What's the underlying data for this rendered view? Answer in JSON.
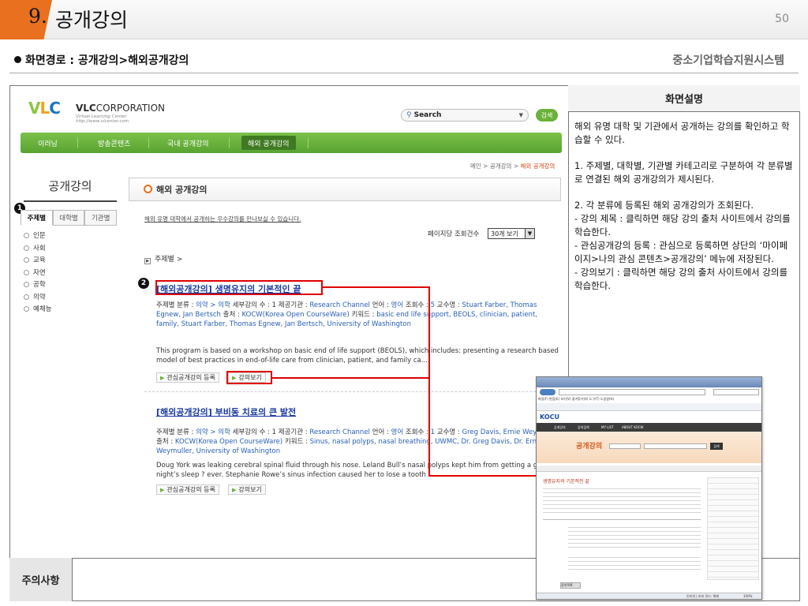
{
  "slide": {
    "section_number": "9.",
    "section_title": "공개강의",
    "page_number": "50",
    "screen_path": "화면경로 : 공개강의>해외공개강의",
    "system_name": "중소기업학습지원시스템"
  },
  "description": {
    "header": "화면설명",
    "summary": "해외 유명 대학 및 기관에서 공개하는 강의를 확인하고 학습할 수 있다.",
    "point1": "1. 주제별, 대학별, 기관별 카테고리로 구분하여 각 분류별로 연결된 해외 공개강의가 제시된다.",
    "point2_title": "2. 각 분류에 등록된 해외 공개강의가 조회된다.",
    "point2_a": "- 강의 제목 : 클릭하면 해당 강의 출처 사이트에서 강의를 학습한다.",
    "point2_b": "- 관심공개강의 등록 : 관심으로 등록하면 상단의 ‘마이페이지>나의 관심 콘텐츠>공개강의’ 메뉴에 저장된다.",
    "point2_c": "- 강의보기 : 클릭하면 해당 강의 출처 사이트에서 강의를 학습한다."
  },
  "notes": {
    "header": "주의사항"
  },
  "site": {
    "logo_mark": "VLC",
    "logo_bold": "VLC",
    "logo_rest": "CORPORATION",
    "logo_sub1": "Virtual Learning Center",
    "logo_sub2": "http://www.vlcenter.com",
    "search_placeholder": "Search",
    "search_button": "검색",
    "nav": [
      "이러닝",
      "방송콘텐츠",
      "국내 공개강의",
      "해외 공개강의"
    ],
    "breadcrumb_pre": "메인 > 공개강의 > ",
    "breadcrumb_current": "해외 공개강의",
    "sidebar_title": "공개강의",
    "sidebar_tabs": [
      "주제별",
      "대학별",
      "기관별"
    ],
    "sidebar_items": [
      "인문",
      "사회",
      "교육",
      "자연",
      "공학",
      "의약",
      "예체능"
    ],
    "content_title": "해외 공개강의",
    "intro": "해외 유명 대학에서 공개하는 우수강의를 만나보실 수 있습니다.",
    "per_page_label": "페이지당 조회건수",
    "per_page_value": "30개 보기",
    "category_path": "주제별 >",
    "badge1": "1",
    "badge2": "2",
    "items": [
      {
        "title": "[해외공개강의] 생명유지의 기본적인 끝",
        "meta1": "주제별 분류 : ",
        "cat_link": "의약 > 의학",
        "meta2": "   세부강의 수 : 1    제공기관 : ",
        "provider": "Research Channel",
        "meta3": "   언어 : ",
        "lang": "영어",
        "meta4": "   조회수 : ",
        "views": "5",
        "meta5": "   교수명 : ",
        "profs": "Stuart Farber, Thomas Egnew, Jan Bertsch",
        "meta6": "   출처 : ",
        "source": "KOCW(Korea Open CourseWare)",
        "meta7": "   키워드 : ",
        "keywords": "basic end life support, BEOLS, clinician, patient, family, Stuart Farber, Thomas Egnew, Jan Bertsch, University of Washington",
        "abstract": "This program is based on a workshop on basic end of life support (BEOLS), which includes: presenting a research based model of best practices in end-of-life care from clinician, patient, and family ca...",
        "btn_fav": "관심공개강의 등록",
        "btn_view": "강의보기"
      },
      {
        "title": "[해외공개강의] 부비동 치료의 큰 발전",
        "meta1": "주제별 분류 : ",
        "cat_link": "의약 > 의학",
        "meta2": "   세부강의 수 : 1    제공기관 : ",
        "provider": "Research Channel",
        "meta3": "   언어 : ",
        "lang": "영어",
        "meta4": "   조회수 : ",
        "views": "1",
        "meta5": "   교수명 : ",
        "profs": "Greg Davis, Ernie Weymuller",
        "meta6": "   출처 : ",
        "source": "KOCW(Korea Open CourseWare)",
        "meta7": "   키워드 : ",
        "keywords": "Sinus, nasal polyps, nasal breathing, UWMC, Dr. Greg Davis, Dr. Ernie Weymuller, University of Washington",
        "abstract": "Doug York was leaking cerebral spinal fluid through his nose. Leland Bull’s nasal polyps kept him from getting a good night’s sleep ? ever. Stephanie Rowe’s sinus infection caused her to lose a tooth ...",
        "btn_fav": "관심공개강의 등록",
        "btn_view": "강의보기"
      }
    ]
  },
  "popup": {
    "logo": "KOCU",
    "banner": "공개강의",
    "lecture_title": "생명유지의 기본적인 끝",
    "search_button": "검색",
    "nav": [
      "공개강의",
      "강의검색",
      "MY LIST",
      "ABOUT KOCW"
    ],
    "menu": "파일(F)  편집(E)  보기(V)  즐겨찾기(A)  도구(T)  도움말(H)",
    "list_button": "강의목록",
    "status": "인터넷 | 보호 모드: 해제",
    "zoom": "100%"
  },
  "colors": {
    "accent_orange": "#e8701e",
    "nav_green": "#58a331",
    "annot_red": "#e00000",
    "link_blue": "#1a3aa0"
  }
}
